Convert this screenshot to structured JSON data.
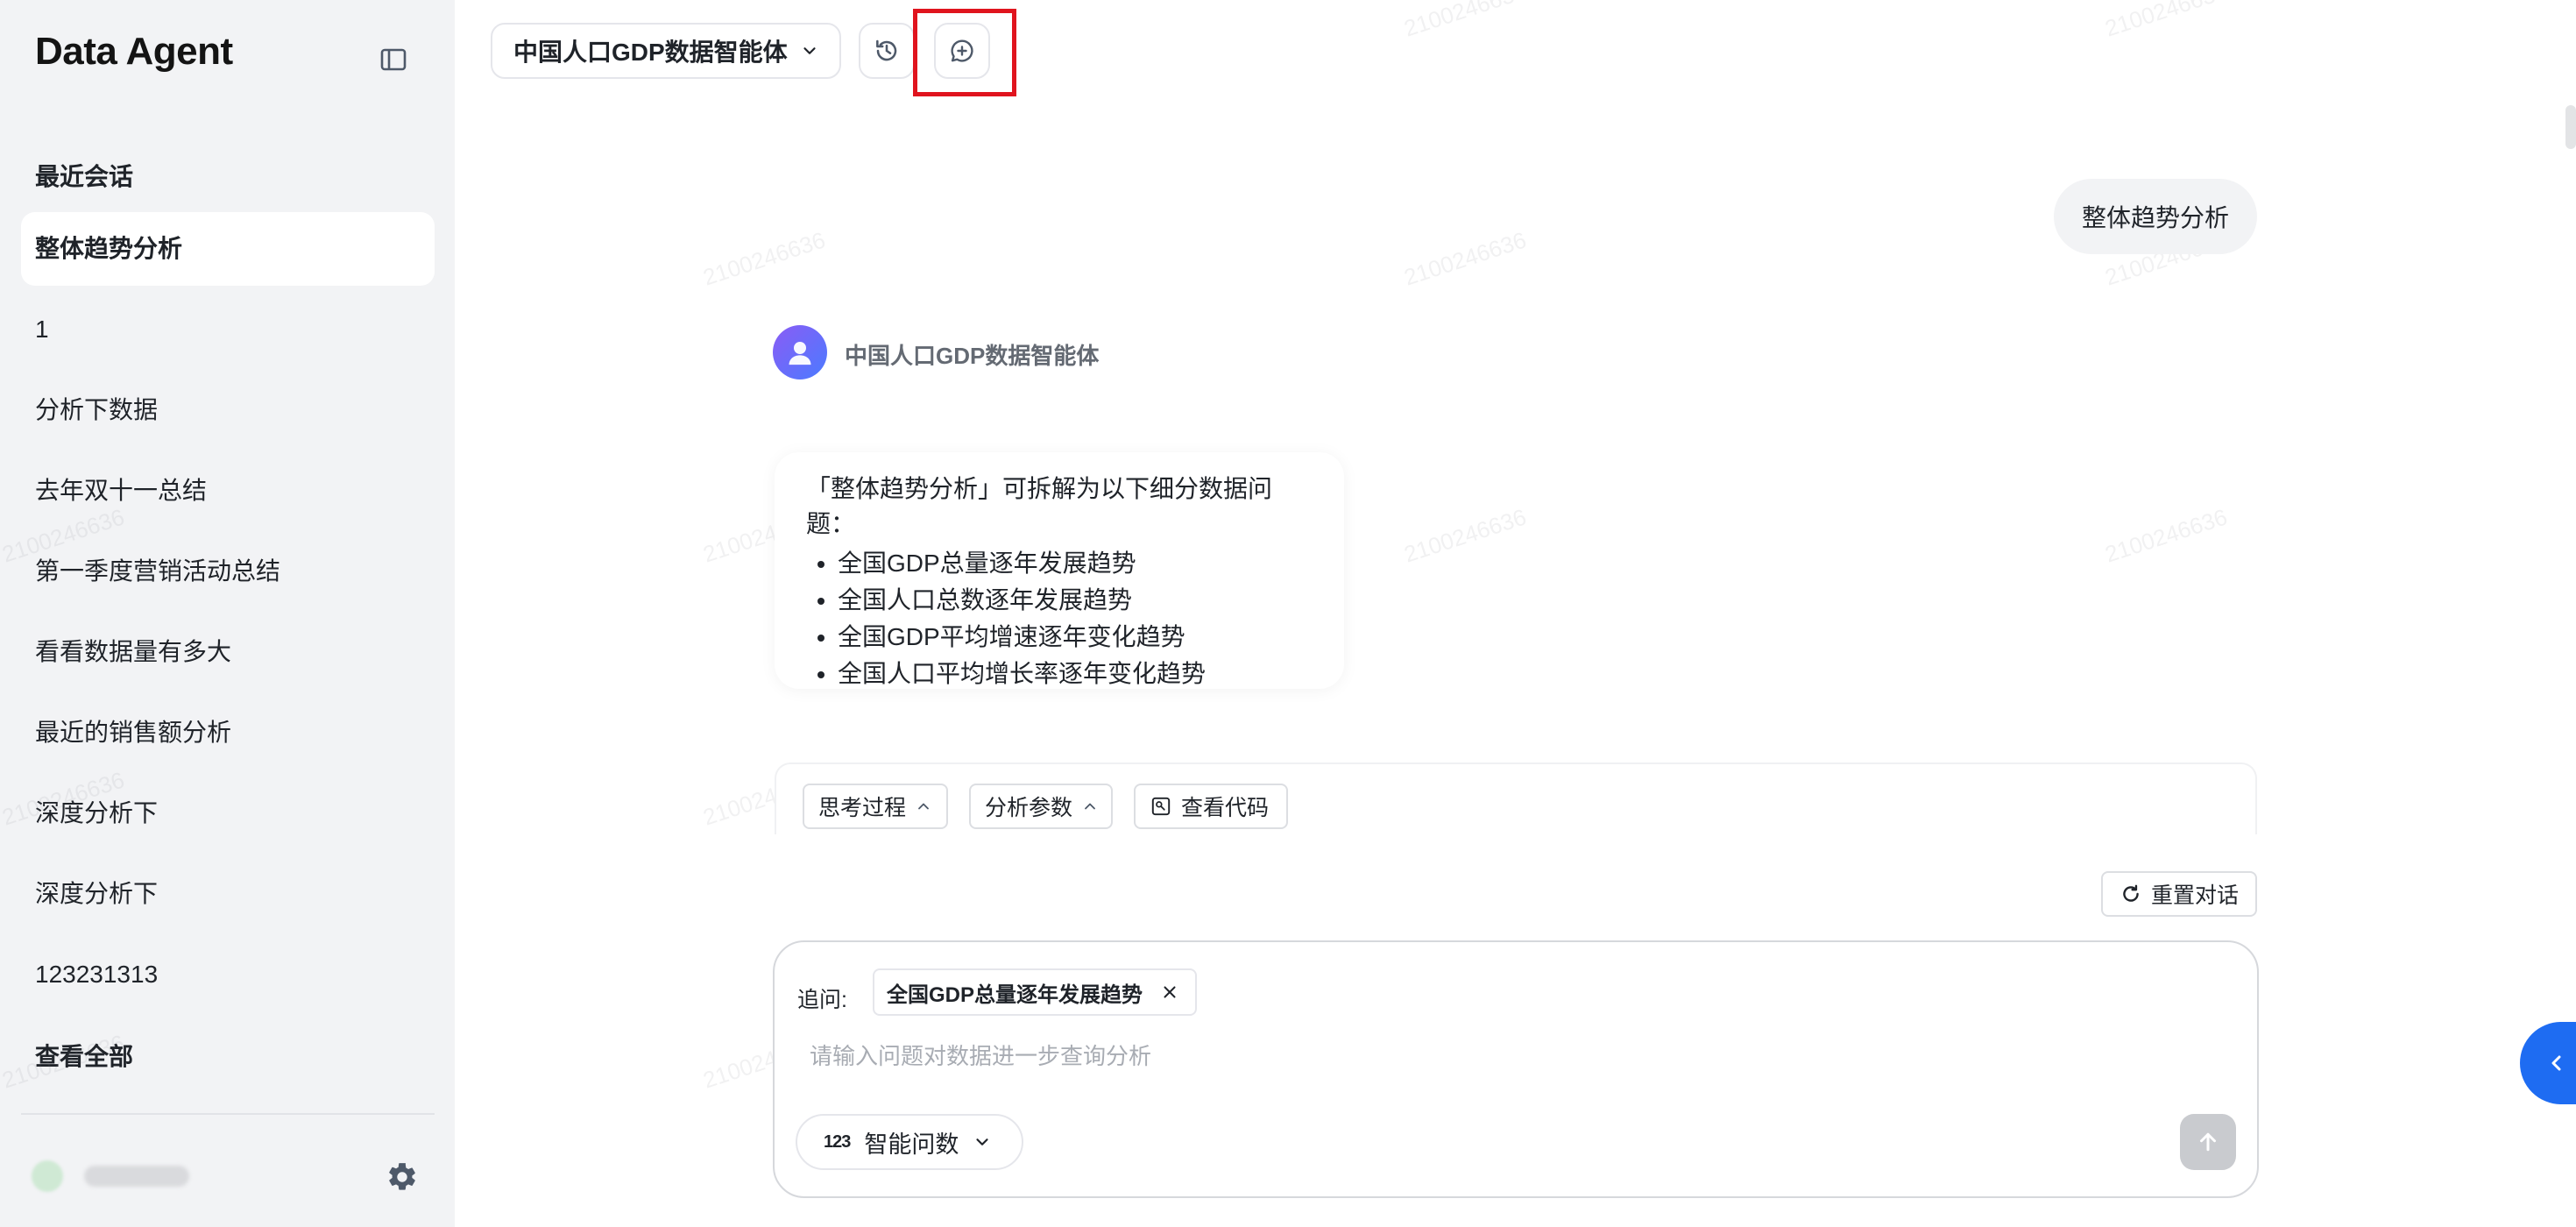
{
  "brand": "Data Agent",
  "sidebar": {
    "recent_title": "最近会话",
    "conversations": [
      "整体趋势分析",
      "1",
      "分析下数据",
      "去年双十一总结",
      "第一季度营销活动总结",
      "看看数据量有多大",
      "最近的销售额分析",
      "深度分析下",
      "深度分析下",
      "123231313"
    ],
    "active_index": 0,
    "view_all": "查看全部"
  },
  "header": {
    "agent_name": "中国人口GDP数据智能体",
    "history_icon": "history-icon",
    "new_chat_icon": "new-chat-icon"
  },
  "watermark": "2100246636",
  "chat": {
    "user_message": "整体趋势分析",
    "bot_name": "中国人口GDP数据智能体",
    "answer_intro": "「整体趋势分析」可拆解为以下细分数据问题：",
    "answer_items": [
      "全国GDP总量逐年发展趋势",
      "全国人口总数逐年发展趋势",
      "全国GDP平均增速逐年变化趋势",
      "全国人口平均增长率逐年变化趋势"
    ],
    "toolbar": {
      "thinking": "思考过程",
      "params": "分析参数",
      "view_code": "查看代码"
    },
    "reset_label": "重置对话"
  },
  "input": {
    "followup_label": "追问:",
    "followup_chip": "全国GDP总量逐年发展趋势",
    "placeholder": "请输入问题对数据进一步查询分析",
    "value": "",
    "mode_icon_text": "123",
    "mode_label": "智能问数"
  },
  "colors": {
    "accent": "#1e6cf2",
    "highlight": "#e0141e",
    "sidebar_bg": "#f2f3f5"
  }
}
